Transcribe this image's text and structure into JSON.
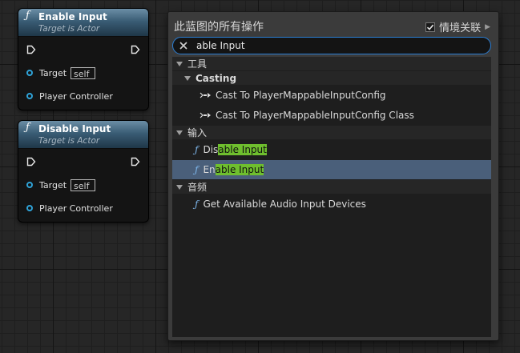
{
  "nodes": [
    {
      "title": "Enable Input",
      "subtitle": "Target is Actor",
      "pins": {
        "target_label": "Target",
        "target_value": "self",
        "controller_label": "Player Controller"
      }
    },
    {
      "title": "Disable Input",
      "subtitle": "Target is Actor",
      "pins": {
        "target_label": "Target",
        "target_value": "self",
        "controller_label": "Player Controller"
      }
    }
  ],
  "menu": {
    "title": "此蓝图的所有操作",
    "context_label": "情境关联",
    "context_checked": true,
    "search_value": "able Input",
    "categories": {
      "tools": "工具",
      "casting": "Casting",
      "input": "输入",
      "audio": "音频"
    },
    "items": {
      "cast1": "Cast To PlayerMappableInputConfig",
      "cast2": "Cast To PlayerMappableInputConfig Class",
      "disable_prefix": "Dis",
      "disable_match": "able Input",
      "enable_prefix": "En",
      "enable_match": "able Input",
      "audio1": "Get Available Audio Input Devices"
    }
  },
  "colors": {
    "accent_search_border": "#2b7fd6",
    "highlight": "#6fbf2e",
    "selected_row": "#4a5f7a",
    "pin_blue": "#2fa3d8"
  }
}
